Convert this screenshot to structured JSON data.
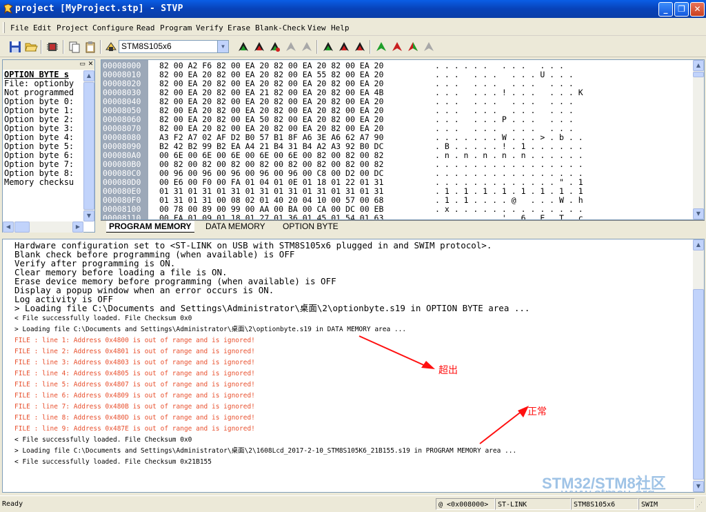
{
  "window": {
    "title": "project [MyProject.stp] - STVP",
    "minimize": "_",
    "maximize": "❐",
    "close": "✕"
  },
  "menu": [
    "File",
    "Edit",
    "Project",
    "Configure",
    "Read",
    "Program",
    "Verify",
    "Erase",
    "Blank-Check",
    "View",
    "Help"
  ],
  "toolbar": {
    "device": "STM8S105x6"
  },
  "info_pane": {
    "close": "✕",
    "lines": [
      "OPTION BYTE s",
      "File: optionby",
      "Not programmed",
      "Option byte 0:",
      "Option byte 1:",
      "Option byte 2:",
      "Option byte 3:",
      "Option byte 4:",
      "Option byte 5:",
      "Option byte 6:",
      "Option byte 7:",
      "Option byte 8:",
      "Memory checksu"
    ]
  },
  "hex_rows": [
    {
      "addr": "00008000",
      "bytes": "82 00 A2 F6 82 00 EA 20 82 00 EA 20 82 00 EA 20",
      "ascii": ". . . . . .   . . .   . . .  "
    },
    {
      "addr": "00008010",
      "bytes": "82 00 EA 20 82 00 EA 20 82 00 EA 55 82 00 EA 20",
      "ascii": ". . .   . . .   . . . U . . .  "
    },
    {
      "addr": "00008020",
      "bytes": "82 00 EA 20 82 00 EA 20 82 00 EA 20 82 00 EA 20",
      "ascii": ". . .   . . .   . . .   . . .  "
    },
    {
      "addr": "00008030",
      "bytes": "82 00 EA 20 82 00 EA 21 82 00 EA 20 82 00 EA 4B",
      "ascii": ". . .   . . . ! . . .   . . . K"
    },
    {
      "addr": "00008040",
      "bytes": "82 00 EA 20 82 00 EA 20 82 00 EA 20 82 00 EA 20",
      "ascii": ". . .   . . .   . . .   . . .  "
    },
    {
      "addr": "00008050",
      "bytes": "82 00 EA 20 82 00 EA 20 82 00 EA 20 82 00 EA 20",
      "ascii": ". . .   . . .   . . .   . . .  "
    },
    {
      "addr": "00008060",
      "bytes": "82 00 EA 20 82 00 EA 50 82 00 EA 20 82 00 EA 20",
      "ascii": ". . .   . . . P . . .   . . .  "
    },
    {
      "addr": "00008070",
      "bytes": "82 00 EA 20 82 00 EA 20 82 00 EA 20 82 00 EA 20",
      "ascii": ". . .   . . .   . . .   . . .  "
    },
    {
      "addr": "00008080",
      "bytes": "A3 F2 A7 02 AF D2 B0 57 B1 8F A6 3E A6 62 A7 90",
      "ascii": ". . . . . . . W . . . > . b . ."
    },
    {
      "addr": "00008090",
      "bytes": "B2 42 B2 99 B2 EA A4 21 B4 31 B4 A2 A3 92 B0 DC",
      "ascii": ". B . . . . . ! . 1 . . . . . ."
    },
    {
      "addr": "000080A0",
      "bytes": "00 6E 00 6E 00 6E 00 6E 00 6E 00 82 00 82 00 82",
      "ascii": ". n . n . n . n . n . . . . . ."
    },
    {
      "addr": "000080B0",
      "bytes": "00 82 00 82 00 82 00 82 00 82 00 82 00 82 00 82",
      "ascii": ". . . . . . . . . . . . . . . ."
    },
    {
      "addr": "000080C0",
      "bytes": "00 96 00 96 00 96 00 96 00 96 00 C8 00 D2 00 DC",
      "ascii": ". . . . . . . . . . . . . . . ."
    },
    {
      "addr": "000080D0",
      "bytes": "00 E6 00 F0 00 FA 01 04 01 0E 01 18 01 22 01 31",
      "ascii": ". . . . . . . . . . . . . \" . 1"
    },
    {
      "addr": "000080E0",
      "bytes": "01 31 01 31 01 31 01 31 01 31 01 31 01 31 01 31",
      "ascii": ". 1 . 1 . 1 . 1 . 1 . 1 . 1 . 1"
    },
    {
      "addr": "000080F0",
      "bytes": "01 31 01 31 00 08 02 01 40 20 04 10 00 57 00 68",
      "ascii": ". 1 . 1 . . . . @   . . . W . h"
    },
    {
      "addr": "00008100",
      "bytes": "00 78 00 89 00 99 00 AA 00 BA 00 CA 00 DC 00 EB",
      "ascii": ". x . . . . . . . . . . . . . ."
    },
    {
      "addr": "00008110",
      "bytes": "00 FA 01 09 01 18 01 27 01 36 01 45 01 54 01 63",
      "ascii": ". . . . . . . ' . 6 . E . T . c"
    }
  ],
  "tabs": [
    "PROGRAM MEMORY",
    "DATA MEMORY",
    "OPTION BYTE"
  ],
  "log": {
    "config": [
      "Hardware configuration set to <ST-LINK on USB with STM8S105x6 plugged in and SWIM protocol>.",
      "Blank check before programming (when available) is OFF",
      "Verify after programming is ON.",
      "Clear memory before loading a file is ON.",
      "Erase device memory before programming (when available) is OFF",
      "Display a popup window when an error occurs is ON.",
      "Log activity is OFF",
      "> Loading file C:\\Documents and Settings\\Administrator\\桌面\\2\\optionbyte.s19 in OPTION BYTE area  ..."
    ],
    "small": [
      "< File successfully loaded. File Checksum 0x0",
      "> Loading file C:\\Documents and Settings\\Administrator\\桌面\\2\\optionbyte.s19 in DATA MEMORY area  ..."
    ],
    "errors": [
      "FILE : line 1: Address 0x4800 is out of range and is ignored!",
      "FILE : line 2: Address 0x4801 is out of range and is ignored!",
      "FILE : line 3: Address 0x4803 is out of range and is ignored!",
      "FILE : line 4: Address 0x4805 is out of range and is ignored!",
      "FILE : line 5: Address 0x4807 is out of range and is ignored!",
      "FILE : line 6: Address 0x4809 is out of range and is ignored!",
      "FILE : line 7: Address 0x480B is out of range and is ignored!",
      "FILE : line 8: Address 0x480D is out of range and is ignored!",
      "FILE : line 9: Address 0x487E is out of range and is ignored!"
    ],
    "tail": [
      "< File successfully loaded. File Checksum 0x0",
      "> Loading file C:\\Documents and Settings\\Administrator\\桌面\\2\\1608Lcd_2017-2-10_STM8S105K6_21B155.s19 in PROGRAM MEMORY area  ...",
      "< File successfully loaded. File Checksum 0x21B155"
    ],
    "annotation_out_of_range": "超出",
    "annotation_normal": "正常",
    "watermark_brand": "STM32/STM8社区",
    "watermark_url": "www.stmcu.org"
  },
  "status": {
    "ready": "Ready",
    "address": "@ <0x008000>",
    "probe": "ST-LINK",
    "device": "STM8S105x6",
    "protocol": "SWIM"
  },
  "colors": {
    "error_text": "#e8502e",
    "annotation": "#ff1010",
    "address_column": "#9ca8b8"
  }
}
